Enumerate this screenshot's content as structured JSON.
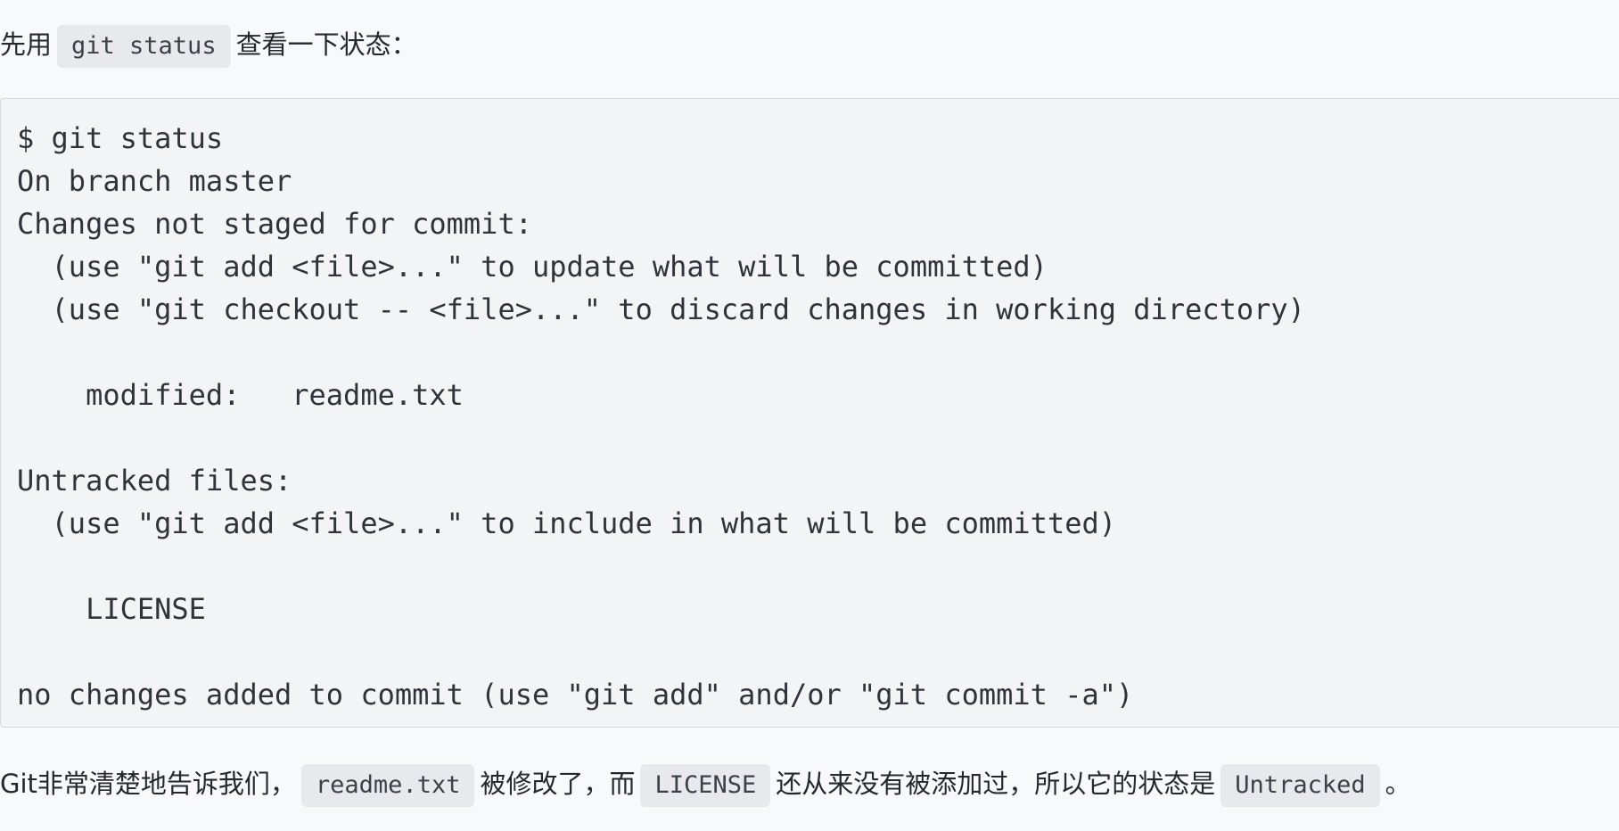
{
  "intro": {
    "text_before": "先用",
    "code": "git status",
    "text_after": "查看一下状态："
  },
  "code_block": {
    "lines": [
      "$ git status",
      "On branch master",
      "Changes not staged for commit:",
      "  (use \"git add <file>...\" to update what will be committed)",
      "  (use \"git checkout -- <file>...\" to discard changes in working directory)",
      "",
      "    modified:   readme.txt",
      "",
      "Untracked files:",
      "  (use \"git add <file>...\" to include in what will be committed)",
      "",
      "    LICENSE",
      "",
      "no changes added to commit (use \"git add\" and/or \"git commit -a\")"
    ]
  },
  "summary": {
    "text_1": "Git非常清楚地告诉我们，",
    "code_1": "readme.txt",
    "text_2": "被修改了，而",
    "code_2": "LICENSE",
    "text_3": "还从来没有被添加过，所以它的状态是",
    "code_3": "Untracked",
    "text_4": "。"
  }
}
